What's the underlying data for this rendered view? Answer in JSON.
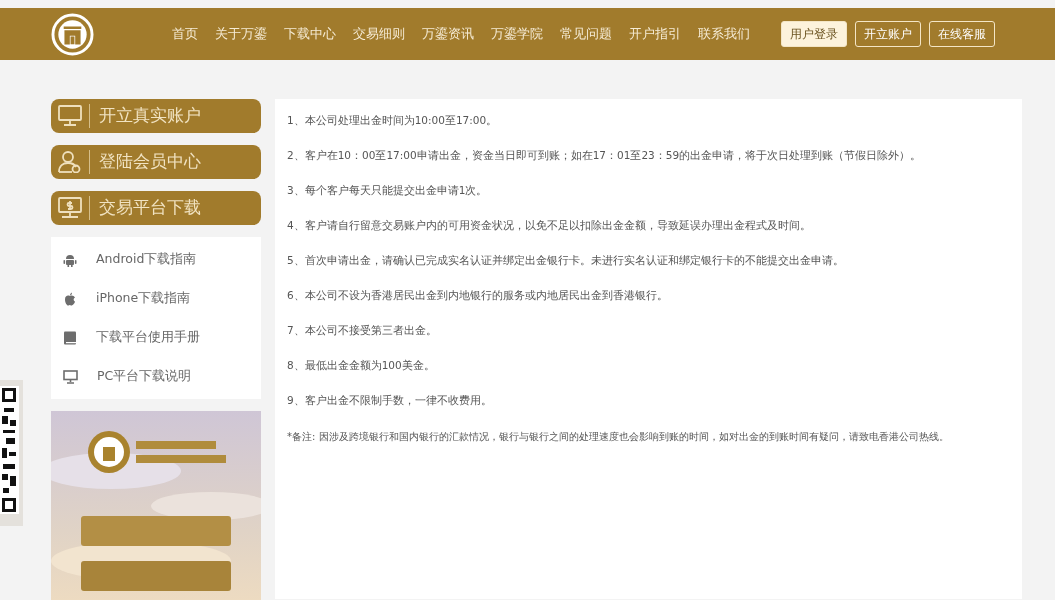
{
  "header": {
    "nav": [
      {
        "label": "首页"
      },
      {
        "label": "关于万鎏"
      },
      {
        "label": "下载中心"
      },
      {
        "label": "交易细则"
      },
      {
        "label": "万鎏资讯"
      },
      {
        "label": "万鎏学院"
      },
      {
        "label": "常见问题"
      },
      {
        "label": "开户指引"
      },
      {
        "label": "联系我们"
      }
    ],
    "buttons": [
      {
        "label": "用户登录",
        "kind": "filled"
      },
      {
        "label": "开立账户",
        "kind": "outline"
      },
      {
        "label": "在线客服",
        "kind": "outline"
      }
    ]
  },
  "sidebar": {
    "actions": [
      {
        "label": "开立真实账户",
        "kind": "monitor"
      },
      {
        "label": "登陆会员中心",
        "kind": "user"
      },
      {
        "label": "交易平台下载",
        "kind": "download"
      }
    ],
    "items": [
      {
        "label": "Android下载指南",
        "kind": "android"
      },
      {
        "label": "iPhone下载指南",
        "kind": "apple"
      },
      {
        "label": "下载平台使用手册",
        "kind": "book"
      },
      {
        "label": "PC平台下载说明",
        "kind": "pc"
      }
    ]
  },
  "content": {
    "rules": [
      "1、本公司处理出金时间为10:00至17:00。",
      "2、客户在10：00至17:00申请出金，资金当日即可到账；如在17：01至23：59的出金申请，将于次日处理到账（节假日除外）。",
      "3、每个客户每天只能提交出金申请1次。",
      "4、客户请自行留意交易账户内的可用资金状况，以免不足以扣除出金金额，导致延误办理出金程式及时间。",
      "5、首次申请出金，请确认已完成实名认证并绑定出金银行卡。未进行实名认证和绑定银行卡的不能提交出金申请。",
      "6、本公司不设为香港居民出金到内地银行的服务或内地居民出金到香港银行。",
      "7、本公司不接受第三者出金。",
      "8、最低出金金额为100美金。",
      "9、客户出金不限制手数，一律不收费用。"
    ],
    "note": "*备注: 因涉及跨境银行和国内银行的汇款情况，银行与银行之间的处理速度也会影响到账的时间，如对出金的到账时间有疑问，请致电香港公司热线。"
  }
}
